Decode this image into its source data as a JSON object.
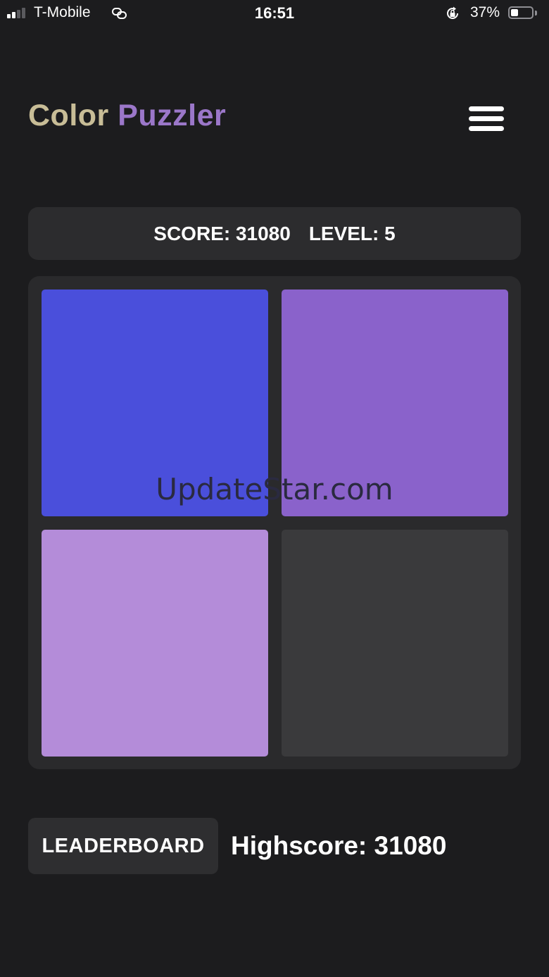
{
  "status_bar": {
    "carrier": "T-Mobile",
    "time": "16:51",
    "battery_percent": "37%",
    "battery_level": 0.37,
    "signal_bars_filled": 2,
    "signal_bars_total": 4,
    "icons": [
      "cellular-signal-icon",
      "personal-hotspot-icon",
      "orientation-lock-icon",
      "battery-icon"
    ]
  },
  "header": {
    "title_part1": "Color",
    "title_part2": "Puzzler",
    "title_color1": "#c8bd97",
    "title_color2": "#9b77c9",
    "menu_icon": "hamburger-menu-icon"
  },
  "score_bar": {
    "score_label": "SCORE: 31080",
    "level_label": "LEVEL: 5"
  },
  "board": {
    "rows": 2,
    "cols": 2,
    "tiles": [
      {
        "row": 0,
        "col": 0,
        "color": "#4a4fdb",
        "empty": false
      },
      {
        "row": 0,
        "col": 1,
        "color": "#8a62cb",
        "empty": false
      },
      {
        "row": 1,
        "col": 0,
        "color": "#b48cd9",
        "empty": false
      },
      {
        "row": 1,
        "col": 1,
        "color": "#3a3a3c",
        "empty": true
      }
    ]
  },
  "watermark": "UpdateStar.com",
  "footer": {
    "leaderboard_label": "LEADERBOARD",
    "highscore_label": "Highscore: 31080"
  },
  "colors": {
    "background": "#1c1c1e",
    "panel": "#2c2c2e",
    "text": "#ffffff"
  }
}
